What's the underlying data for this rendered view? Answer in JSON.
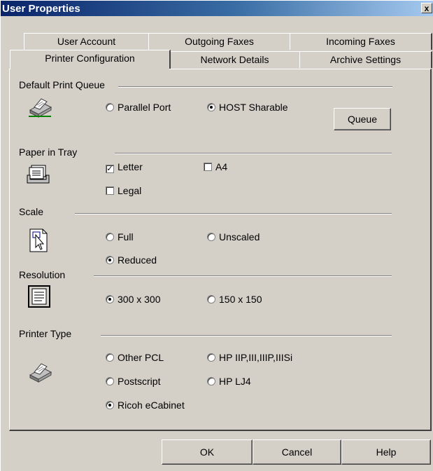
{
  "window": {
    "title": "User Properties",
    "close_glyph": "x"
  },
  "tabs": {
    "row1": [
      "User Account",
      "Outgoing Faxes",
      "Incoming Faxes"
    ],
    "row2": [
      "Printer Configuration",
      "Network Details",
      "Archive Settings"
    ],
    "active": "Printer Configuration"
  },
  "default_print_queue": {
    "label": "Default Print Queue",
    "options": [
      {
        "label": "Parallel Port",
        "selected": false
      },
      {
        "label": "HOST Sharable",
        "selected": true
      }
    ],
    "queue_button": "Queue",
    "icon": "printer-icon"
  },
  "paper_in_tray": {
    "label": "Paper in Tray",
    "options": [
      {
        "label": "Letter",
        "checked": true
      },
      {
        "label": "A4",
        "checked": false
      },
      {
        "label": "Legal",
        "checked": false
      }
    ],
    "icon": "paper-tray-icon"
  },
  "scale": {
    "label": "Scale",
    "options": [
      {
        "label": "Full",
        "selected": false
      },
      {
        "label": "Unscaled",
        "selected": false
      },
      {
        "label": "Reduced",
        "selected": true
      }
    ],
    "icon": "scale-cursor-icon"
  },
  "resolution": {
    "label": "Resolution",
    "options": [
      {
        "label": "300 x 300",
        "selected": true
      },
      {
        "label": "150 x 150",
        "selected": false
      }
    ],
    "icon": "document-icon"
  },
  "printer_type": {
    "label": "Printer Type",
    "options": [
      {
        "label": "Other PCL",
        "selected": false
      },
      {
        "label": "HP IIP,III,IIIP,IIISi",
        "selected": false
      },
      {
        "label": "Postscript",
        "selected": false
      },
      {
        "label": "HP LJ4",
        "selected": false
      },
      {
        "label": "Ricoh eCabinet",
        "selected": true
      }
    ],
    "icon": "printer-icon"
  },
  "buttons": {
    "ok": "OK",
    "cancel": "Cancel",
    "help": "Help"
  }
}
